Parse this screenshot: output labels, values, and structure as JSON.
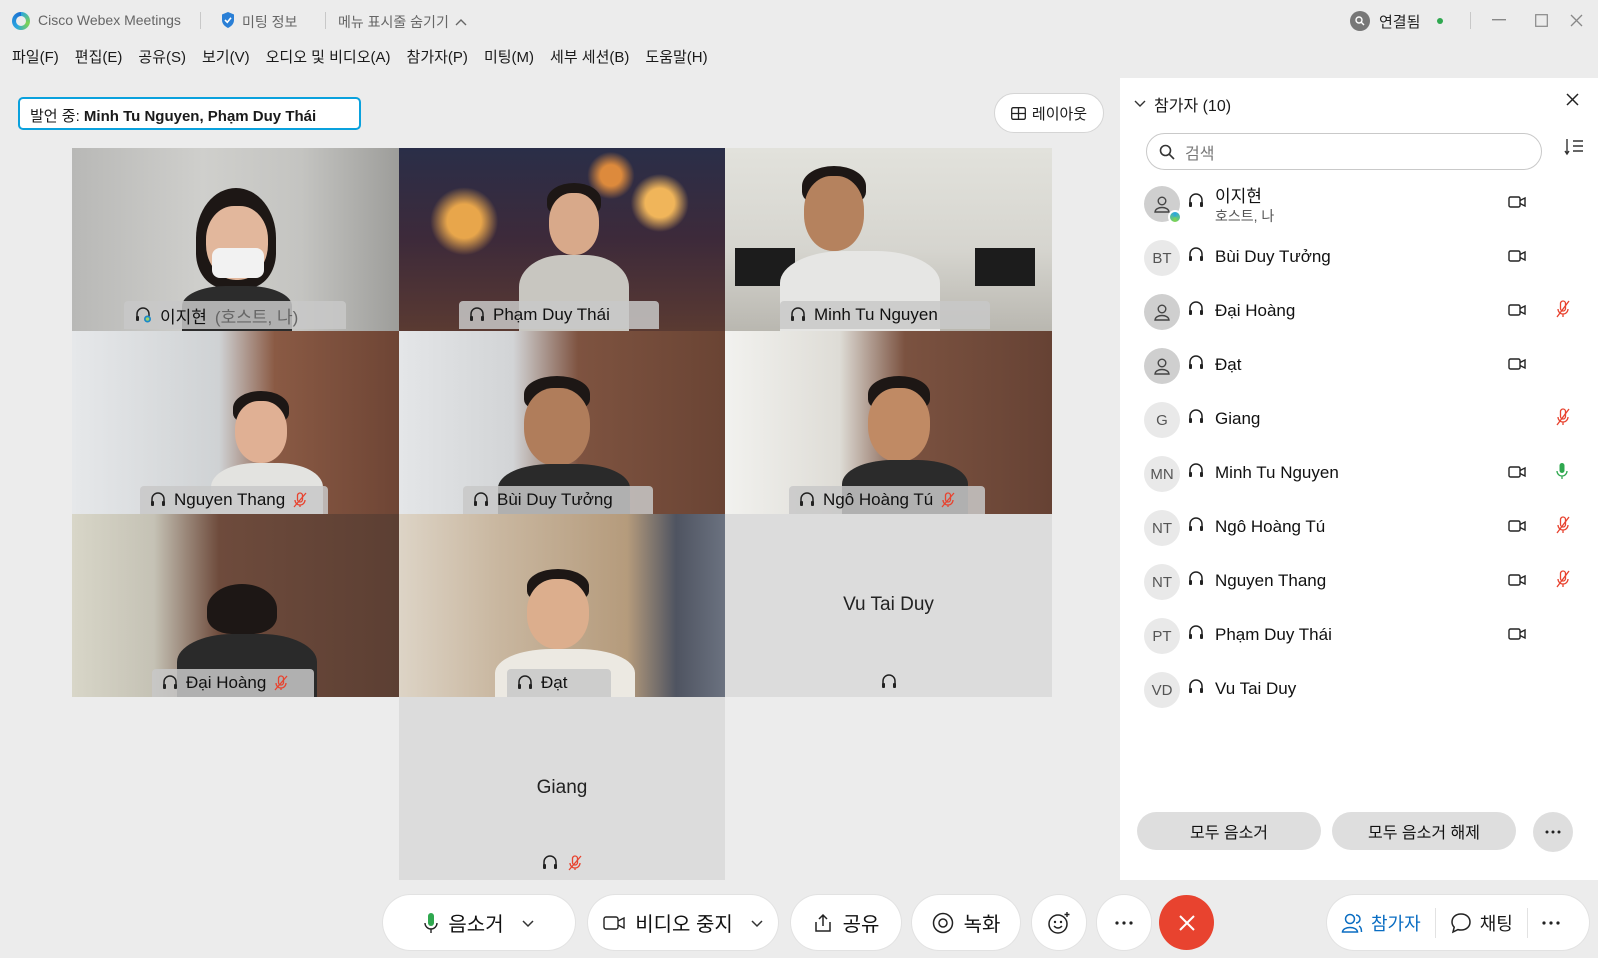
{
  "titlebar": {
    "app_title": "Cisco Webex Meetings",
    "meeting_info": "미팅 정보",
    "hide_menu": "메뉴 표시줄 숨기기",
    "connection_status": "연결됨",
    "connection_color": "#2fa84f"
  },
  "menubar": [
    "파일(F)",
    "편집(E)",
    "공유(S)",
    "보기(V)",
    "오디오 및 비디오(A)",
    "참가자(P)",
    "미팅(M)",
    "세부 세션(B)",
    "도움말(H)"
  ],
  "speaking": {
    "label": "발언 중:",
    "names": "Minh Tu Nguyen, Phạm Duy Thái"
  },
  "layout_button": "레이아웃",
  "video_tiles": [
    {
      "name": "이지현",
      "sub": "(호스트, 나)",
      "muted": false
    },
    {
      "name": "Phạm Duy Thái",
      "muted": false
    },
    {
      "name": "Minh Tu Nguyen",
      "muted": false
    },
    {
      "name": "Nguyen Thang",
      "muted": true
    },
    {
      "name": "Bùi Duy Tưởng",
      "muted": false
    },
    {
      "name": "Ngô Hoàng Tú",
      "muted": true
    },
    {
      "name": "Đại Hoàng",
      "muted": true
    },
    {
      "name": "Đạt",
      "muted": false
    },
    {
      "name": "Vu Tai Duy",
      "muted": false
    },
    {
      "name": "Giang",
      "muted": true
    }
  ],
  "panel": {
    "title": "참가자 (10)",
    "search_placeholder": "검색",
    "participants": [
      {
        "initials": "",
        "name": "이지현",
        "role": "호스트, 나",
        "video": true,
        "mic": ""
      },
      {
        "initials": "BT",
        "name": "Bùi Duy Tưởng",
        "role": "",
        "video": true,
        "mic": ""
      },
      {
        "initials": "",
        "name": "Đại Hoàng",
        "role": "",
        "video": true,
        "mic": "muted"
      },
      {
        "initials": "",
        "name": "Đạt",
        "role": "",
        "video": true,
        "mic": ""
      },
      {
        "initials": "G",
        "name": "Giang",
        "role": "",
        "video": false,
        "mic": "muted"
      },
      {
        "initials": "MN",
        "name": "Minh Tu Nguyen",
        "role": "",
        "video": true,
        "mic": "active"
      },
      {
        "initials": "NT",
        "name": "Ngô Hoàng Tú",
        "role": "",
        "video": true,
        "mic": "muted"
      },
      {
        "initials": "NT",
        "name": "Nguyen Thang",
        "role": "",
        "video": true,
        "mic": "muted"
      },
      {
        "initials": "PT",
        "name": "Phạm Duy Thái",
        "role": "",
        "video": true,
        "mic": ""
      },
      {
        "initials": "VD",
        "name": "Vu Tai Duy",
        "role": "",
        "video": false,
        "mic": ""
      }
    ],
    "mute_all": "모두 음소거",
    "unmute_all": "모두 음소거 해제"
  },
  "controls": {
    "mute": "음소거",
    "stop_video": "비디오 중지",
    "share": "공유",
    "record": "녹화",
    "participants": "참가자",
    "chat": "채팅"
  },
  "colors": {
    "accent": "#0aa1dd",
    "end_call": "#e8432f",
    "muted_red": "#e8432f",
    "mic_green": "#2fa84f"
  }
}
